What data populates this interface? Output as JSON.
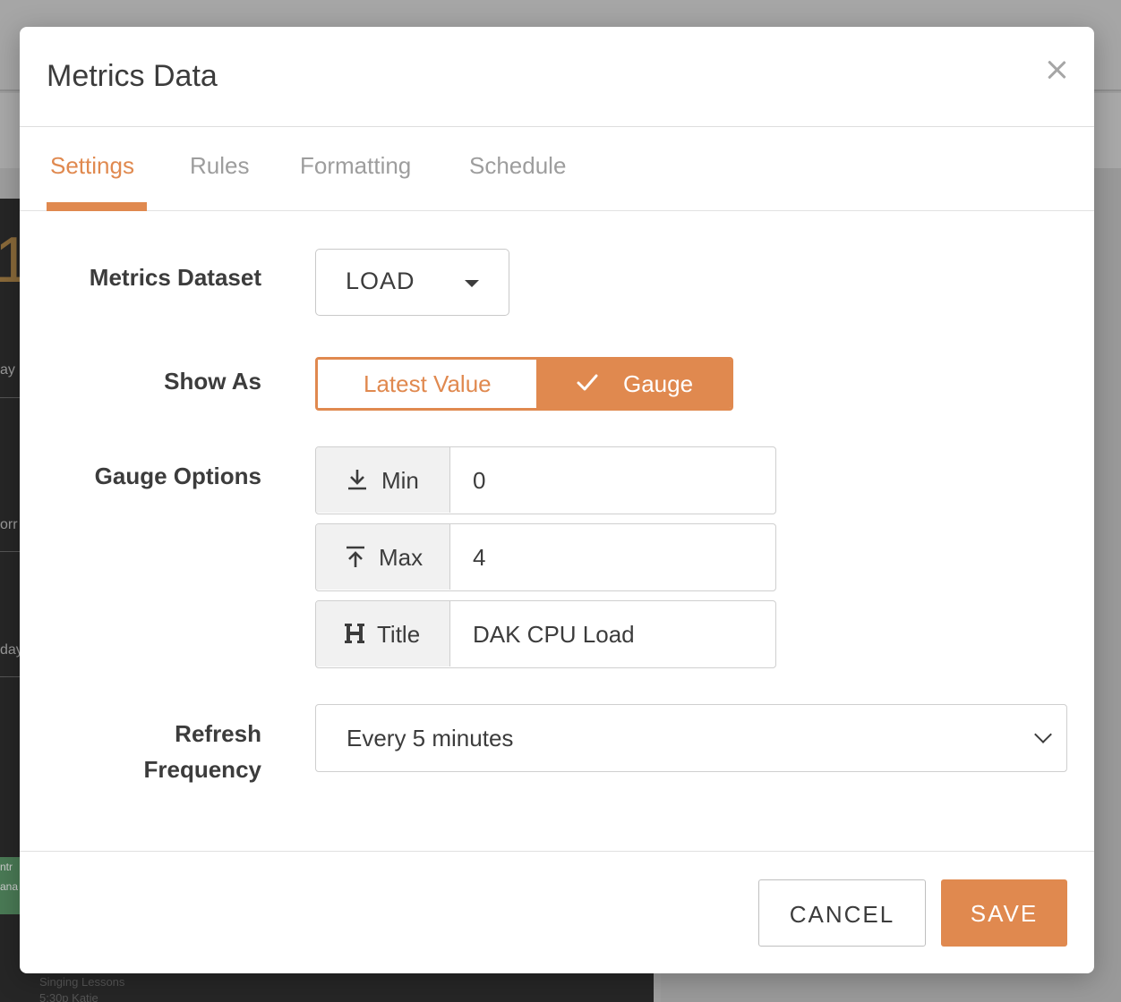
{
  "background": {
    "number": "1",
    "fragments": [
      "ay",
      "orr",
      "day"
    ],
    "footer_lines": [
      "Singing Lessons",
      "5:30p Katie"
    ],
    "side_fragments": [
      "ntr",
      "ana"
    ]
  },
  "modal": {
    "title": "Metrics Data",
    "close_icon": "close-icon"
  },
  "tabs": [
    {
      "label": "Settings",
      "active": true
    },
    {
      "label": "Rules",
      "active": false
    },
    {
      "label": "Formatting",
      "active": false
    },
    {
      "label": "Schedule",
      "active": false
    }
  ],
  "form": {
    "dataset": {
      "label": "Metrics Dataset",
      "value": "LOAD"
    },
    "show_as": {
      "label": "Show As",
      "options": [
        {
          "label": "Latest Value",
          "selected": false
        },
        {
          "label": "Gauge",
          "selected": true
        }
      ]
    },
    "gauge_options": {
      "label": "Gauge Options",
      "fields": [
        {
          "addon": "Min",
          "icon": "download-icon",
          "value": "0"
        },
        {
          "addon": "Max",
          "icon": "upload-icon",
          "value": "4"
        },
        {
          "addon": "Title",
          "icon": "heading-icon",
          "value": "DAK CPU Load"
        }
      ]
    },
    "refresh": {
      "label_line1": "Refresh",
      "label_line2": "Frequency",
      "value": "Every 5 minutes"
    }
  },
  "buttons": {
    "cancel": "CANCEL",
    "save": "SAVE"
  },
  "colors": {
    "accent": "#e0894f",
    "text": "#3c3c3c",
    "muted": "#9d9d9d"
  }
}
